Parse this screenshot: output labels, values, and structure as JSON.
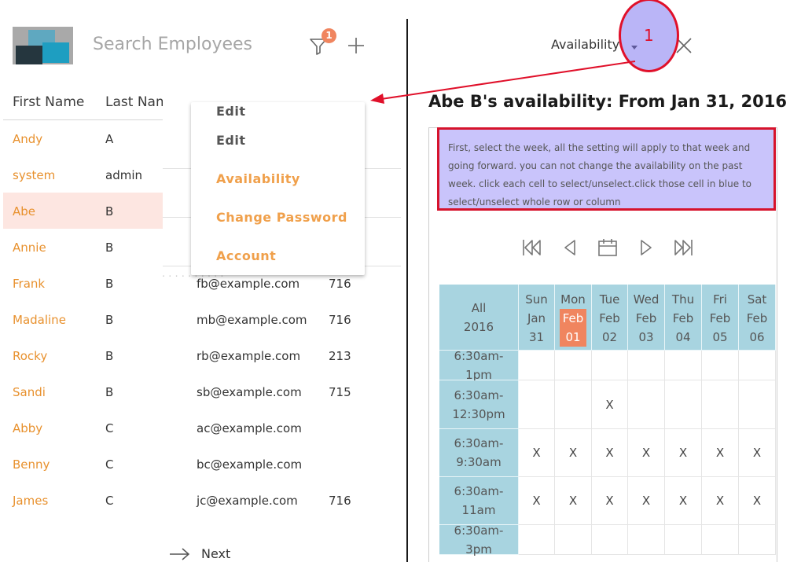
{
  "search": {
    "placeholder": "Search Employees",
    "filter_count": "1"
  },
  "table": {
    "headers": [
      "First Name",
      "Last Nam"
    ],
    "rows": [
      {
        "first": "Andy",
        "last": "A",
        "email": "",
        "num": ""
      },
      {
        "first": "system",
        "last": "admin",
        "email": "",
        "num": ""
      },
      {
        "first": "Abe",
        "last": "B",
        "email": "",
        "num": ""
      },
      {
        "first": "Annie",
        "last": "B",
        "email": "",
        "num": ""
      },
      {
        "first": "Frank",
        "last": "B",
        "email": "fb@example.com",
        "num": "716"
      },
      {
        "first": "Madaline",
        "last": "B",
        "email": "mb@example.com",
        "num": "716"
      },
      {
        "first": "Rocky",
        "last": "B",
        "email": "rb@example.com",
        "num": "213"
      },
      {
        "first": "Sandi",
        "last": "B",
        "email": "sb@example.com",
        "num": "715"
      },
      {
        "first": "Abby",
        "last": "C",
        "email": "ac@example.com",
        "num": ""
      },
      {
        "first": "Benny",
        "last": "C",
        "email": "bc@example.com",
        "num": ""
      },
      {
        "first": "James",
        "last": "C",
        "email": "jc@example.com",
        "num": "716"
      }
    ]
  },
  "menu": {
    "items": [
      "Edit",
      "Edit",
      "Availability",
      "Change Password",
      "Account"
    ]
  },
  "pager": {
    "next_label": "Next"
  },
  "header": {
    "view_label": "Availability",
    "annotation_number": "1"
  },
  "availability": {
    "title": "Abe B's availability: From Jan 31, 2016",
    "instructions": "First, select the week, all the setting will apply to that week and going forward. you can not change the availability on the past week. click each cell to select/unselect.click those cell in blue to select/unselect whole row or column",
    "all_label": "All",
    "year": "2016",
    "days": [
      {
        "dow": "Sun",
        "mon": "Jan",
        "day": "31"
      },
      {
        "dow": "Mon",
        "mon": "Feb",
        "day": "01"
      },
      {
        "dow": "Tue",
        "mon": "Feb",
        "day": "02"
      },
      {
        "dow": "Wed",
        "mon": "Feb",
        "day": "03"
      },
      {
        "dow": "Thu",
        "mon": "Feb",
        "day": "04"
      },
      {
        "dow": "Fri",
        "mon": "Feb",
        "day": "05"
      },
      {
        "dow": "Sat",
        "mon": "Feb",
        "day": "06"
      }
    ],
    "slots": [
      {
        "label": "6:30am-1pm",
        "marks": [
          "",
          "",
          "",
          "",
          "",
          "",
          ""
        ]
      },
      {
        "label": "6:30am-12:30pm",
        "marks": [
          "",
          "",
          "X",
          "",
          "",
          "",
          ""
        ]
      },
      {
        "label": "6:30am-9:30am",
        "marks": [
          "X",
          "X",
          "X",
          "X",
          "X",
          "X",
          "X"
        ]
      },
      {
        "label": "6:30am-11am",
        "marks": [
          "X",
          "X",
          "X",
          "X",
          "X",
          "X",
          "X"
        ]
      },
      {
        "label": "6:30am-3pm",
        "marks": [
          "",
          "",
          "",
          "",
          "",
          "",
          ""
        ]
      }
    ]
  },
  "colors": {
    "accent": "#e8912e",
    "selected_row": "#fde6e1",
    "header_cell": "#a8d4e0",
    "today": "#f0855f",
    "annotation": "#e0102a"
  }
}
